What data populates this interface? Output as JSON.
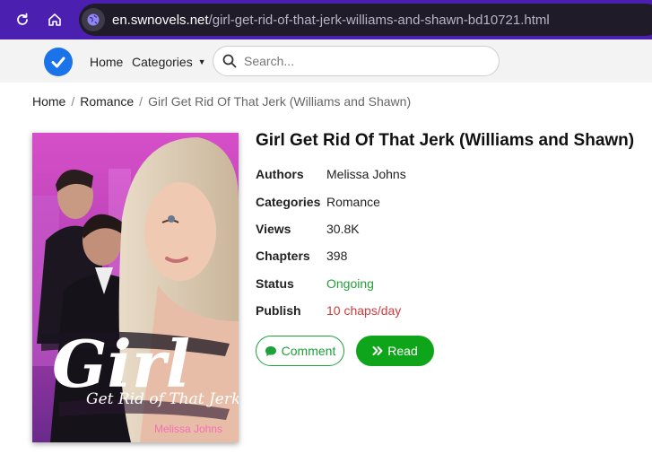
{
  "browser": {
    "url_host": "en.swnovels.net",
    "url_path": "/girl-get-rid-of-that-jerk-williams-and-shawn-bd10721.html"
  },
  "header": {
    "home_label": "Home",
    "categories_label": "Categories",
    "search_placeholder": "Search..."
  },
  "breadcrumb": {
    "home": "Home",
    "category": "Romance",
    "current": "Girl Get Rid Of That Jerk (Williams and Shawn)"
  },
  "cover": {
    "title_big": "Girl",
    "subtitle": "Get Rid of That Jerk!",
    "author": "Melissa Johns"
  },
  "book": {
    "title": "Girl Get Rid Of That Jerk (Williams and Shawn)",
    "info": [
      {
        "label": "Authors",
        "value": "Melissa Johns"
      },
      {
        "label": "Categories",
        "value": "Romance"
      },
      {
        "label": "Views",
        "value": "30.8K"
      },
      {
        "label": "Chapters",
        "value": "398"
      },
      {
        "label": "Status",
        "value": "Ongoing"
      },
      {
        "label": "Publish",
        "value": "10 chaps/day"
      }
    ]
  },
  "actions": {
    "comment_label": "Comment",
    "read_label": "Read"
  },
  "colors": {
    "browser_bar": "#4b1fb0",
    "accent_green": "#0fa51b",
    "status_green": "#22a038",
    "publish_red": "#d03b3b",
    "logo_blue": "#1a73e8"
  }
}
